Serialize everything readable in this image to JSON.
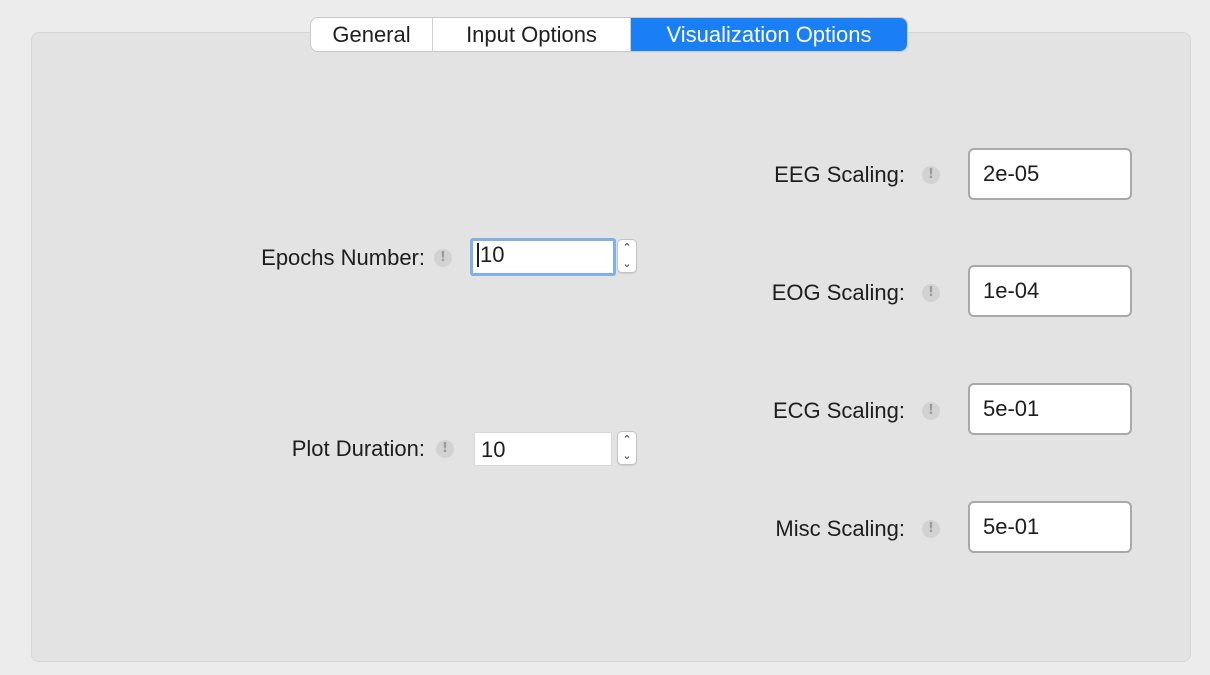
{
  "tabs": [
    {
      "label": "General",
      "active": false
    },
    {
      "label": "Input Options",
      "active": false
    },
    {
      "label": "Visualization Options",
      "active": true
    }
  ],
  "accent_color": "#1a7ef5",
  "info_icon_glyph": "!",
  "left_fields": {
    "epochs_number": {
      "label": "Epochs Number:",
      "value": "10",
      "focused": true
    },
    "plot_duration": {
      "label": "Plot Duration:",
      "value": "10",
      "focused": false
    }
  },
  "stepper": {
    "up_glyph": "⌃",
    "down_glyph": "⌄"
  },
  "scalings": {
    "eeg": {
      "label": "EEG Scaling:",
      "value": "2e-05"
    },
    "eog": {
      "label": "EOG Scaling:",
      "value": "1e-04"
    },
    "ecg": {
      "label": "ECG Scaling:",
      "value": "5e-01"
    },
    "misc": {
      "label": "Misc Scaling:",
      "value": "5e-01"
    }
  }
}
